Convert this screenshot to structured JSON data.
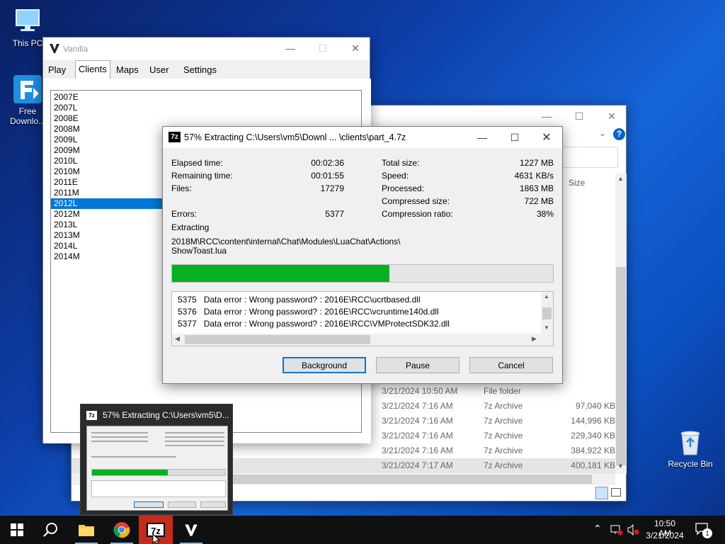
{
  "desktop": {
    "icons": [
      {
        "label": "This PC"
      },
      {
        "label": "Free Downlo..."
      },
      {
        "label": "Recycle Bin"
      }
    ]
  },
  "vanilla_window": {
    "title": "Vanilla",
    "tabs": [
      "Play",
      "Clients",
      "Maps",
      "User",
      "Settings"
    ],
    "active_tab": "Clients",
    "clients": [
      "2007E",
      "2007L",
      "2008E",
      "2008M",
      "2009L",
      "2009M",
      "2010L",
      "2010M",
      "2011E",
      "2011M",
      "2012L",
      "2012M",
      "2013L",
      "2013M",
      "2014L",
      "2014M"
    ],
    "selected_client": "2012L"
  },
  "explorer_window": {
    "column_size": "Size",
    "rows": [
      {
        "date": "3/21/2024 10:50 AM",
        "type": "File folder",
        "size": ""
      },
      {
        "date": "3/21/2024 7:16 AM",
        "type": "7z Archive",
        "size": "97,040 KB"
      },
      {
        "date": "3/21/2024 7:16 AM",
        "type": "7z Archive",
        "size": "144,996 KB"
      },
      {
        "date": "3/21/2024 7:16 AM",
        "type": "7z Archive",
        "size": "229,340 KB"
      },
      {
        "date": "3/21/2024 7:16 AM",
        "type": "7z Archive",
        "size": "384,922 KB"
      },
      {
        "date": "3/21/2024 7:17 AM",
        "type": "7z Archive",
        "size": "400,181 KB"
      }
    ]
  },
  "zip_dialog": {
    "title": "57% Extracting C:\\Users\\vm5\\Downl ... \\clients\\part_4.7z",
    "app_icon": "7z",
    "elapsed_label": "Elapsed time:",
    "elapsed_value": "00:02:36",
    "remaining_label": "Remaining time:",
    "remaining_value": "00:01:55",
    "files_label": "Files:",
    "files_value": "17279",
    "errors_label": "Errors:",
    "errors_value": "5377",
    "total_label": "Total size:",
    "total_value": "1227 MB",
    "speed_label": "Speed:",
    "speed_value": "4631 KB/s",
    "processed_label": "Processed:",
    "processed_value": "1863 MB",
    "compressed_label": "Compressed size:",
    "compressed_value": "722 MB",
    "ratio_label": "Compression ratio:",
    "ratio_value": "38%",
    "extracting_label": "Extracting",
    "current_path_line1": "2018M\\RCC\\content\\internal\\Chat\\Modules\\LuaChat\\Actions\\",
    "current_path_line2": "ShowToast.lua",
    "progress_fraction": 0.57,
    "progress_color": "#06b025",
    "log": [
      "5375   Data error : Wrong password? : 2016E\\RCC\\ucrtbased.dll",
      "5376   Data error : Wrong password? : 2016E\\RCC\\vcruntime140d.dll",
      "5377   Data error : Wrong password? : 2016E\\RCC\\VMProtectSDK32.dll"
    ],
    "btn_background": "Background",
    "btn_pause": "Pause",
    "btn_cancel": "Cancel"
  },
  "thumbnail": {
    "title": "57% Extracting C:\\Users\\vm5\\D..."
  },
  "taskbar": {
    "time": "10:50 AM",
    "date": "3/21/2024",
    "notification_count": "1"
  }
}
